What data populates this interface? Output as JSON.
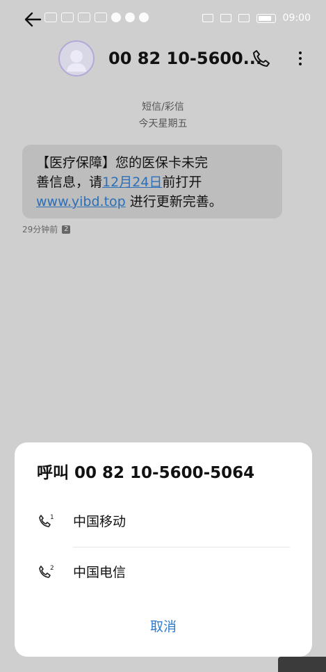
{
  "status_bar": {
    "time": "09:00"
  },
  "header": {
    "title": "00 82 10-5600..."
  },
  "conversation": {
    "channel": "短信/彩信",
    "day": "今天星期五",
    "message": {
      "line1": "【医疗保障】您的医保卡未完",
      "line2_prefix": "善信息，请",
      "date_link": "12月24日",
      "line2_suffix": "前打开",
      "url_link": "www.yibd.top",
      "line3_suffix": " 进行更新完善。"
    },
    "timestamp": "29分钟前",
    "sim_badge": "2"
  },
  "dialog": {
    "title": "呼叫 00 82 10-5600-5064",
    "options": [
      {
        "label": "中国移动",
        "sim": "1",
        "icon": "phone-sim1-icon"
      },
      {
        "label": "中国电信",
        "sim": "2",
        "icon": "phone-sim2-icon"
      }
    ],
    "cancel": "取消"
  },
  "colors": {
    "link": "#2b6fb8",
    "accent": "#2b7bd0",
    "backdrop": "#cfcfcf"
  }
}
